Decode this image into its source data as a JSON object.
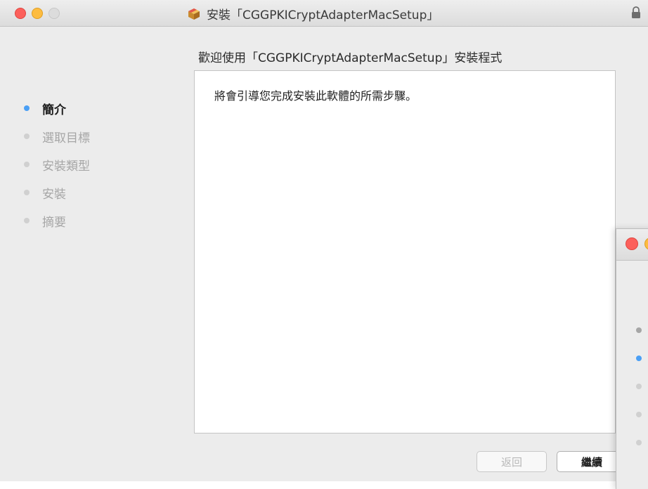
{
  "window": {
    "title": "安裝「CGGPKICryptAdapterMacSetup」",
    "heading": "歡迎使用「CGGPKICryptAdapterMacSetup」安裝程式",
    "icons": {
      "package": "package-icon",
      "lock": "lock-icon"
    }
  },
  "sidebar": {
    "steps": [
      {
        "label": "簡介",
        "active": true
      },
      {
        "label": "選取目標",
        "active": false
      },
      {
        "label": "安裝類型",
        "active": false
      },
      {
        "label": "安裝",
        "active": false
      },
      {
        "label": "摘要",
        "active": false
      }
    ]
  },
  "content": {
    "text": "將會引導您完成安裝此軟體的所需步驟。"
  },
  "buttons": {
    "back": "返回",
    "continue": "繼續"
  },
  "colors": {
    "accent": "#4a9ff5",
    "close": "#fc605b",
    "minimize": "#fdbc40"
  }
}
